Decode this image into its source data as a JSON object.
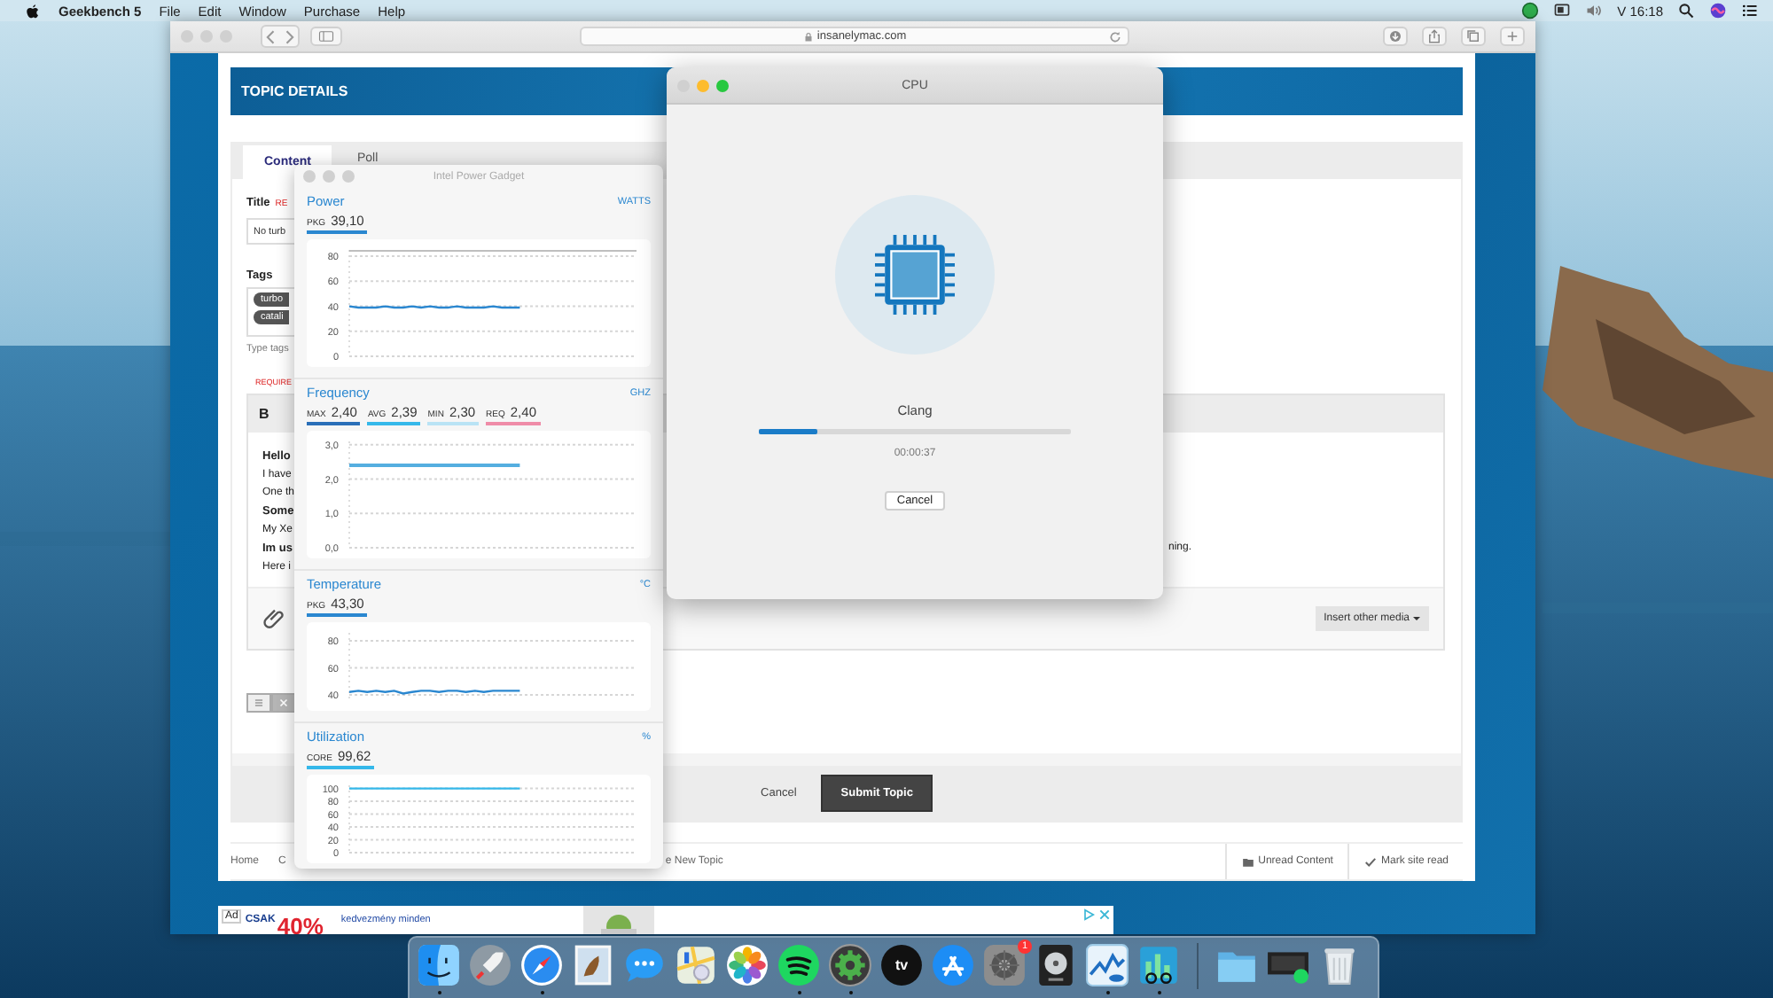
{
  "menu_bar": {
    "app_name": "Geekbench 5",
    "menus": [
      "File",
      "Edit",
      "Window",
      "Purchase",
      "Help"
    ],
    "status_icons": [
      {
        "kind": "green-dot"
      },
      {
        "kind": "screen"
      },
      {
        "kind": "volume"
      }
    ],
    "clock": "V 16:18",
    "right_icons": [
      {
        "kind": "search"
      },
      {
        "kind": "siri"
      },
      {
        "kind": "list"
      }
    ]
  },
  "browser": {
    "controls": [
      {
        "active": false
      },
      {
        "active": false
      },
      {
        "active": false
      }
    ],
    "address": "insanelymac.com",
    "page": {
      "header": "TOPIC DETAILS",
      "tabs": [
        {
          "label": "Content",
          "selected": true
        },
        {
          "label": "Poll",
          "selected": false
        }
      ],
      "title_label": "Title",
      "title_required": "RE",
      "title_value": "No turb",
      "tags_label": "Tags",
      "tags": [
        "turbo",
        "catali"
      ],
      "tags_hint": "Type tags",
      "content_required": "REQUIRE",
      "bold_button": "B",
      "editor_lines": [
        {
          "text": "Hello",
          "bold": true
        },
        {
          "text": "I have",
          "bold": false
        },
        {
          "text": "One th",
          "bold": false
        },
        {
          "text": "Some",
          "bold": true
        },
        {
          "text": "My Xe",
          "bold": false
        },
        {
          "text": "Im us",
          "bold": true,
          "tail": "ning."
        },
        {
          "text": "Here i",
          "bold": false
        }
      ],
      "insert_media": "Insert other media",
      "view_toggle": [
        {
          "kind": "list",
          "selected": true
        },
        {
          "kind": "close",
          "selected": false
        }
      ],
      "cancel": "Cancel",
      "submit": "Submit Topic",
      "breadcrumb": [
        "Home",
        "C",
        "e New Topic"
      ],
      "footer_links": [
        {
          "kind": "folder",
          "label": "Unread Content"
        },
        {
          "kind": "check",
          "label": "Mark site read"
        }
      ]
    },
    "ad": {
      "badge": "Ad",
      "lead": "CSAK",
      "big": "40%",
      "text": "kedvezmény minden"
    }
  },
  "power_gadget": {
    "title": "Intel Power Gadget",
    "controls": [
      {
        "active": false
      },
      {
        "active": false
      },
      {
        "active": false
      }
    ],
    "sections": [
      {
        "title": "Power",
        "unit": "WATTS",
        "readings": [
          {
            "label": "PKG",
            "value": "39,10",
            "color": "#2a87d0"
          }
        ],
        "chart_data": {
          "type": "line",
          "grid": true,
          "ylim": [
            0,
            85
          ],
          "yticks": [
            0,
            20,
            40,
            60,
            80
          ],
          "series": [
            {
              "color": "#2a87d0",
              "values": [
                40,
                39,
                39,
                39,
                40,
                39,
                39,
                40,
                39,
                40,
                39,
                39,
                40,
                39,
                39,
                39,
                40,
                39,
                39,
                39,
                null,
                null,
                null,
                null,
                null,
                null,
                null,
                null,
                null,
                null,
                null,
                null,
                null
              ]
            }
          ]
        }
      },
      {
        "title": "Frequency",
        "unit": "GHZ",
        "readings": [
          {
            "label": "MAX",
            "value": "2,40",
            "color": "#2a6fb8"
          },
          {
            "label": "AVG",
            "value": "2,39",
            "color": "#35b8ea"
          },
          {
            "label": "MIN",
            "value": "2,30",
            "color": "#b9e3f5"
          },
          {
            "label": "REQ",
            "value": "2,40",
            "color": "#ef8ca8"
          }
        ],
        "chart_data": {
          "type": "line",
          "grid": true,
          "ylim": [
            0,
            3.1
          ],
          "yticks": [
            {
              "value": 0,
              "label": "0,0"
            },
            {
              "value": 1,
              "label": "1,0"
            },
            {
              "value": 2,
              "label": "2,0"
            },
            {
              "value": 3,
              "label": "3,0"
            }
          ],
          "series": [
            {
              "color": "#55aee0",
              "values": [
                2.4,
                2.4,
                2.4,
                2.4,
                2.4,
                2.4,
                2.4,
                2.4,
                2.4,
                2.4,
                2.4,
                2.4,
                2.4,
                2.4,
                2.4,
                2.4,
                2.4,
                2.4,
                2.4,
                2.4,
                null,
                null,
                null,
                null,
                null,
                null,
                null,
                null,
                null,
                null,
                null,
                null,
                null
              ]
            }
          ]
        }
      },
      {
        "title": "Temperature",
        "unit": "°C",
        "readings": [
          {
            "label": "PKG",
            "value": "43,30",
            "color": "#2a87d0"
          }
        ],
        "chart_data": {
          "type": "line",
          "grid": true,
          "ylim": [
            36,
            86
          ],
          "yticks": [
            40,
            60,
            80
          ],
          "series": [
            {
              "color": "#2a87d0",
              "values": [
                42,
                43,
                42,
                43,
                42,
                43,
                41,
                42,
                43,
                43,
                42,
                43,
                43,
                42,
                43,
                42,
                43,
                43,
                43,
                43,
                null,
                null,
                null,
                null,
                null,
                null,
                null,
                null,
                null,
                null,
                null,
                null,
                null
              ]
            }
          ]
        }
      },
      {
        "title": "Utilization",
        "unit": "%",
        "readings": [
          {
            "label": "CORE",
            "value": "99,62",
            "color": "#35b8ea"
          }
        ],
        "chart_data": {
          "type": "line",
          "grid": true,
          "ylim": [
            0,
            105
          ],
          "yticks": [
            0,
            20,
            40,
            60,
            80,
            100
          ],
          "series": [
            {
              "color": "#35b8ea",
              "values": [
                100,
                100,
                100,
                100,
                100,
                100,
                100,
                100,
                100,
                100,
                100,
                100,
                100,
                100,
                100,
                100,
                100,
                100,
                100,
                100,
                null,
                null,
                null,
                null,
                null,
                null,
                null,
                null,
                null,
                null,
                null,
                null,
                null
              ]
            }
          ]
        }
      }
    ]
  },
  "cpu_window": {
    "title": "CPU",
    "controls": [
      {
        "active": false
      },
      {
        "active": true
      },
      {
        "active": true
      }
    ],
    "task": "Clang",
    "level": 0.19,
    "elapsed": "00:00:37",
    "button": "Cancel"
  },
  "dock": [
    {
      "kind": "finder",
      "running": true
    },
    {
      "kind": "launchpad",
      "running": false
    },
    {
      "kind": "safari",
      "running": true
    },
    {
      "kind": "preview",
      "running": false
    },
    {
      "kind": "messages",
      "running": false
    },
    {
      "kind": "maps",
      "running": false
    },
    {
      "kind": "photos",
      "running": false
    },
    {
      "kind": "spotify",
      "running": true
    },
    {
      "kind": "gear",
      "running": true
    },
    {
      "kind": "tv",
      "running": false,
      "label": "tv"
    },
    {
      "kind": "appstore",
      "running": false
    },
    {
      "kind": "settings",
      "running": false,
      "badge": "1"
    },
    {
      "kind": "disk",
      "running": false
    },
    {
      "kind": "gadget",
      "running": true
    },
    {
      "kind": "bench",
      "running": true
    },
    {
      "kind": "separator"
    },
    {
      "kind": "folder",
      "running": false
    },
    {
      "kind": "monitor",
      "running": false
    },
    {
      "kind": "trash",
      "running": false
    }
  ]
}
